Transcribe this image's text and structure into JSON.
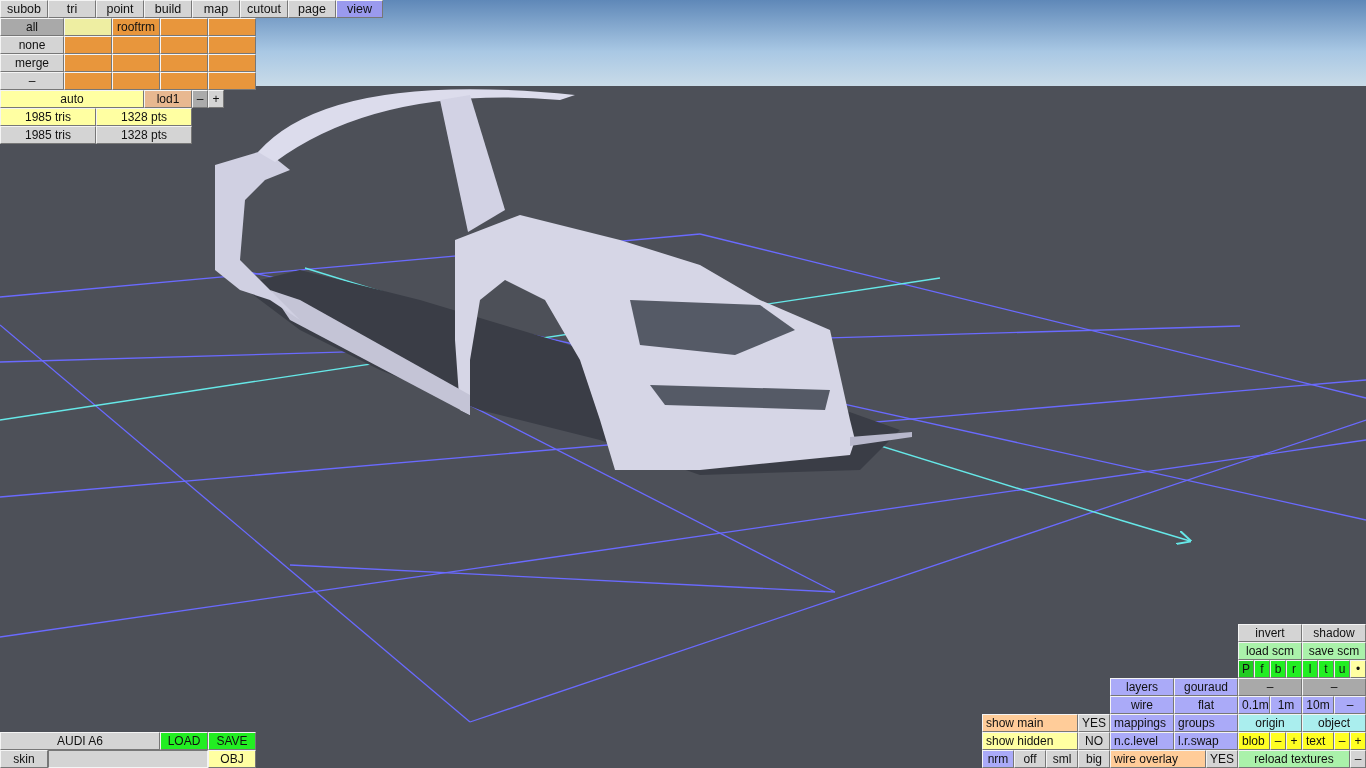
{
  "tabs": [
    {
      "label": "subob",
      "selected": false
    },
    {
      "label": "tri",
      "selected": false
    },
    {
      "label": "point",
      "selected": false
    },
    {
      "label": "build",
      "selected": false
    },
    {
      "label": "map",
      "selected": false
    },
    {
      "label": "cutout",
      "selected": false
    },
    {
      "label": "page",
      "selected": false
    },
    {
      "label": "view",
      "selected": true
    }
  ],
  "top_left": [
    {
      "items": [
        {
          "label": "all",
          "color": "#a9a9a9"
        },
        {
          "color": "#eeeea2"
        },
        {
          "label": "rooftrm",
          "color": "#e8963c"
        },
        {
          "color": "#e8963c"
        },
        {
          "color": "#e8963c"
        }
      ]
    },
    {
      "items": [
        {
          "label": "none",
          "color": "#d4d4d4"
        },
        {
          "color": "#e8963c"
        },
        {
          "color": "#e8963c"
        },
        {
          "color": "#e8963c"
        },
        {
          "color": "#e8963c"
        }
      ]
    },
    {
      "items": [
        {
          "label": "merge",
          "color": "#d4d4d4"
        },
        {
          "color": "#e8963c"
        },
        {
          "color": "#e8963c"
        },
        {
          "color": "#e8963c"
        },
        {
          "color": "#e8963c"
        }
      ]
    },
    {
      "items": [
        {
          "label": "–",
          "color": "#d4d4d4"
        },
        {
          "color": "#e8963c"
        },
        {
          "color": "#e8963c"
        },
        {
          "color": "#e8963c"
        },
        {
          "color": "#e8963c"
        }
      ]
    },
    {
      "items": [
        {
          "label": "auto",
          "color": "#ffffa2"
        },
        {
          "label": "lod1",
          "color": "#e8b890"
        },
        {
          "label": "–",
          "color": "#ababab"
        },
        {
          "label": "+",
          "color": "#d4d4d4"
        }
      ]
    },
    {
      "items": [
        {
          "label": "1985 tris",
          "color": "#ffffa2"
        },
        {
          "label": "1328 pts",
          "color": "#ffffa2"
        }
      ]
    },
    {
      "items": [
        {
          "label": "1985 tris",
          "color": "#d4d4d4"
        },
        {
          "label": "1328 pts",
          "color": "#d4d4d4"
        }
      ]
    }
  ],
  "bottom_left": [
    {
      "items": [
        {
          "label": "AUDI A6",
          "color": "#d4d4d4"
        },
        {
          "label": "LOAD",
          "color": "#22ee22"
        },
        {
          "label": "SAVE",
          "color": "#22ee22"
        }
      ]
    },
    {
      "items": [
        {
          "label": "skin",
          "color": "#d4d4d4"
        },
        {
          "kind": "field",
          "color": "#d4d4d4"
        },
        {
          "label": "OBJ",
          "color": "#ffffa2"
        }
      ]
    }
  ],
  "bottom_right": [
    {
      "items": [
        {
          "label": "invert",
          "color": "#d4d4d4"
        },
        {
          "label": "shadow",
          "color": "#d4d4d4"
        }
      ]
    },
    {
      "items": [
        {
          "label": "load scm",
          "color": "#aaf2aa"
        },
        {
          "label": "save scm",
          "color": "#aaf2aa"
        }
      ]
    },
    {
      "items": [
        {
          "label": "P",
          "color": "#22cc22"
        },
        {
          "label": "f",
          "color": "#22ee22"
        },
        {
          "label": "b",
          "color": "#22ee22"
        },
        {
          "label": "r",
          "color": "#22ee22"
        },
        {
          "label": "l",
          "color": "#22ee22"
        },
        {
          "label": "t",
          "color": "#22ee22"
        },
        {
          "label": "u",
          "color": "#22ee22"
        },
        {
          "label": "•",
          "color": "#ffffa2"
        }
      ]
    },
    {
      "items": [
        {
          "label": "layers",
          "color": "#aaaaf8"
        },
        {
          "label": "gouraud",
          "color": "#aaaaf8"
        },
        {
          "label": "–",
          "color": "#a9a9a9"
        },
        {
          "label": "–",
          "color": "#a9a9a9"
        }
      ]
    },
    {
      "items": [
        {
          "label": "wire",
          "color": "#aaaaf8"
        },
        {
          "label": "flat",
          "color": "#aaaaf8"
        },
        {
          "label": "0.1m",
          "color": "#aaaaf8"
        },
        {
          "label": "1m",
          "color": "#aaaaf8"
        },
        {
          "label": "10m",
          "color": "#aaaaf8"
        },
        {
          "label": "–",
          "color": "#aaaaf8"
        }
      ]
    },
    {
      "items": [
        {
          "label": "show main",
          "color": "#ffcc99"
        },
        {
          "label": "YES",
          "color": "#d4d4d4"
        },
        {
          "label": "mappings",
          "color": "#aaaaf8"
        },
        {
          "label": "groups",
          "color": "#aaaaf8"
        },
        {
          "label": "origin",
          "color": "#aaeeee"
        },
        {
          "label": "object",
          "color": "#aaeeee"
        }
      ]
    },
    {
      "items": [
        {
          "label": "show hidden",
          "color": "#ffffa2"
        },
        {
          "label": "NO",
          "color": "#d4d4d4"
        },
        {
          "label": "n.c.level",
          "color": "#aaaaf8"
        },
        {
          "label": "l.r.swap",
          "color": "#aaaaf8"
        },
        {
          "label": "blob",
          "color": "#ffff22"
        },
        {
          "label": "–",
          "color": "#ffff22"
        },
        {
          "label": "+",
          "color": "#ffff22"
        },
        {
          "label": "text",
          "color": "#ffff22"
        },
        {
          "label": "–",
          "color": "#ffff22"
        },
        {
          "label": "+",
          "color": "#ffff22"
        }
      ]
    },
    {
      "items": [
        {
          "label": "nrm",
          "color": "#aaaaf8"
        },
        {
          "label": "off",
          "color": "#d4d4d4"
        },
        {
          "label": "sml",
          "color": "#d4d4d4"
        },
        {
          "label": "big",
          "color": "#d4d4d4"
        },
        {
          "label": "wire overlay",
          "color": "#ffcc99"
        },
        {
          "label": "YES",
          "color": "#d4d4d4"
        },
        {
          "label": "reload textures",
          "color": "#aaf2aa"
        },
        {
          "label": "–",
          "color": "#d4d4d4"
        }
      ]
    }
  ]
}
